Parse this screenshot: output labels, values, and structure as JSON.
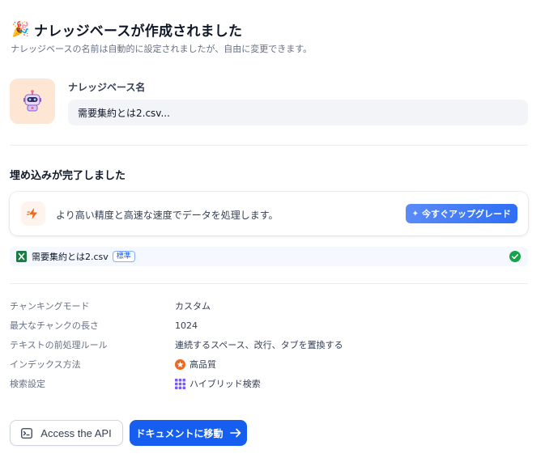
{
  "header": {
    "title": "ナレッジベースが作成されました",
    "subtitle": "ナレッジベースの名前は自動的に設定されましたが、自由に変更できます。",
    "title_icon": "party-popper-icon"
  },
  "knowledge_base": {
    "avatar_icon": "robot-icon",
    "name_label": "ナレッジベース名",
    "name_value": "需要集約とは2.csv..."
  },
  "embedding": {
    "section_title": "埋め込みが完了しました",
    "upgrade": {
      "icon": "lightning-icon",
      "text": "より高い精度と高速な速度でデータを処理します。",
      "button_label": "今すぐアップグレード",
      "button_icon": "sparkle-icon"
    },
    "file": {
      "icon": "excel-icon",
      "name": "需要集約とは2.csv",
      "badge": "標準",
      "status_icon": "check-circle-icon"
    }
  },
  "settings": [
    {
      "key": "チャンキングモード",
      "value": "カスタム",
      "icon": ""
    },
    {
      "key": "最大なチャンクの長さ",
      "value": "1024",
      "icon": ""
    },
    {
      "key": "テキストの前処理ルール",
      "value": "連続するスペース、改行、タブを置換する",
      "icon": ""
    },
    {
      "key": "インデックス方法",
      "value": "高品質",
      "icon": "high-quality-icon"
    },
    {
      "key": "検索設定",
      "value": "ハイブリッド検索",
      "icon": "hybrid-search-icon"
    }
  ],
  "actions": {
    "api_label": "Access the API",
    "api_icon": "terminal-icon",
    "docs_label": "ドキュメントに移動",
    "docs_icon": "arrow-right-icon"
  },
  "colors": {
    "primary": "#155eef",
    "avatar_bg": "#fde6d4",
    "success": "#16a34a",
    "excel_green": "#1d7a45"
  }
}
